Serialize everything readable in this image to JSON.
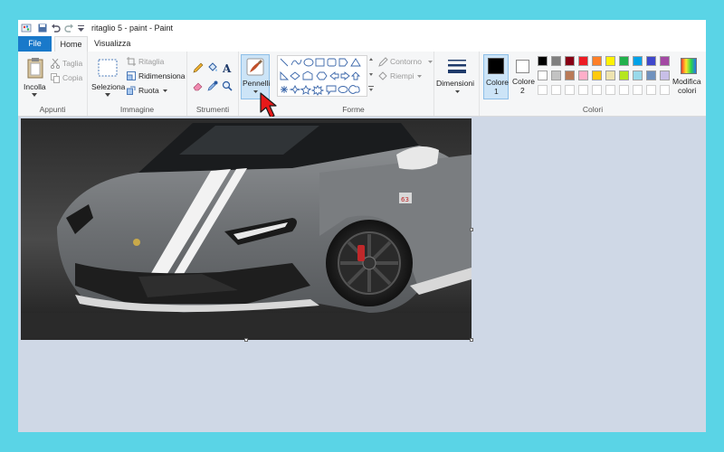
{
  "titlebar": {
    "title": "ritaglio 5 - paint - Paint",
    "app_icon": "paint-palette-icon",
    "quick_access": [
      "save-icon",
      "undo-icon",
      "redo-icon",
      "customize-dropdown-icon"
    ]
  },
  "menu": {
    "file": "File",
    "home": "Home",
    "view": "Visualizza"
  },
  "ribbon": {
    "clipboard": {
      "group_label": "Appunti",
      "paste": "Incolla",
      "cut": "Taglia",
      "copy": "Copia"
    },
    "image": {
      "group_label": "Immagine",
      "select": "Seleziona",
      "crop": "Ritaglia",
      "resize": "Ridimensiona",
      "rotate": "Ruota"
    },
    "tools": {
      "group_label": "Strumenti",
      "items": [
        "pencil-icon",
        "fill-bucket-icon",
        "text-icon",
        "eraser-icon",
        "color-picker-icon",
        "magnifier-icon"
      ]
    },
    "brushes": {
      "label": "Pennelli"
    },
    "shapes": {
      "group_label": "Forme",
      "outline": "Contorno",
      "fill": "Riempi"
    },
    "size": {
      "label": "Dimensioni"
    },
    "colors": {
      "group_label": "Colori",
      "color1_label": "Colore",
      "color1_num": "1",
      "color2_label": "Colore",
      "color2_num": "2",
      "edit_colors_label": "Modifica",
      "edit_colors_label2": "colori",
      "color1_value": "#000000",
      "color2_value": "#ffffff",
      "palette_row1": [
        "#000000",
        "#7f7f7f",
        "#880015",
        "#ed1c24",
        "#ff7f27",
        "#fff200",
        "#22b14c",
        "#00a2e8",
        "#3f48cc",
        "#a349a4"
      ],
      "palette_row2": [
        "#ffffff",
        "#c3c3c3",
        "#b97a57",
        "#ffaec9",
        "#ffc90e",
        "#efe4b0",
        "#b5e61d",
        "#99d9ea",
        "#7092be",
        "#c8bfe7"
      ],
      "palette_row3": [
        "#ffffff",
        "#ffffff",
        "#ffffff",
        "#ffffff",
        "#ffffff",
        "#ffffff",
        "#ffffff",
        "#ffffff",
        "#ffffff",
        "#ffffff"
      ]
    }
  },
  "canvas": {
    "image_description": "photo-car",
    "background": "#cfd8e6"
  },
  "cursor": "red-arrow-cursor-icon"
}
